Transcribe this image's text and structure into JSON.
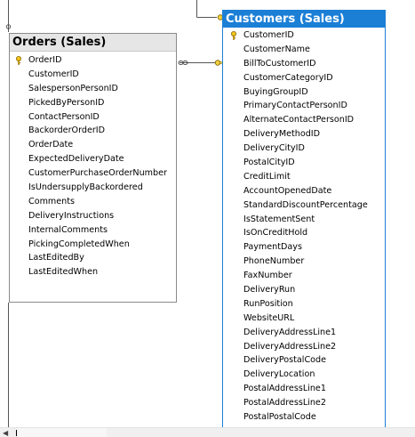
{
  "orders_table": {
    "title": "Orders (Sales)",
    "columns": [
      {
        "name": "OrderID",
        "key": true
      },
      {
        "name": "CustomerID"
      },
      {
        "name": "SalespersonPersonID"
      },
      {
        "name": "PickedByPersonID"
      },
      {
        "name": "ContactPersonID"
      },
      {
        "name": "BackorderOrderID"
      },
      {
        "name": "OrderDate"
      },
      {
        "name": "ExpectedDeliveryDate"
      },
      {
        "name": "CustomerPurchaseOrderNumber"
      },
      {
        "name": "IsUndersupplyBackordered"
      },
      {
        "name": "Comments"
      },
      {
        "name": "DeliveryInstructions"
      },
      {
        "name": "InternalComments"
      },
      {
        "name": "PickingCompletedWhen"
      },
      {
        "name": "LastEditedBy"
      },
      {
        "name": "LastEditedWhen"
      }
    ]
  },
  "customers_table": {
    "title": "Customers (Sales)",
    "selected": true,
    "columns": [
      {
        "name": "CustomerID",
        "key": true
      },
      {
        "name": "CustomerName"
      },
      {
        "name": "BillToCustomerID"
      },
      {
        "name": "CustomerCategoryID"
      },
      {
        "name": "BuyingGroupID"
      },
      {
        "name": "PrimaryContactPersonID"
      },
      {
        "name": "AlternateContactPersonID"
      },
      {
        "name": "DeliveryMethodID"
      },
      {
        "name": "DeliveryCityID"
      },
      {
        "name": "PostalCityID"
      },
      {
        "name": "CreditLimit"
      },
      {
        "name": "AccountOpenedDate"
      },
      {
        "name": "StandardDiscountPercentage"
      },
      {
        "name": "IsStatementSent"
      },
      {
        "name": "IsOnCreditHold"
      },
      {
        "name": "PaymentDays"
      },
      {
        "name": "PhoneNumber"
      },
      {
        "name": "FaxNumber"
      },
      {
        "name": "DeliveryRun"
      },
      {
        "name": "RunPosition"
      },
      {
        "name": "WebsiteURL"
      },
      {
        "name": "DeliveryAddressLine1"
      },
      {
        "name": "DeliveryAddressLine2"
      },
      {
        "name": "DeliveryPostalCode"
      },
      {
        "name": "DeliveryLocation"
      },
      {
        "name": "PostalAddressLine1"
      },
      {
        "name": "PostalAddressLine2"
      },
      {
        "name": "PostalPostalCode"
      }
    ]
  },
  "icons": {
    "primary_key": "key-icon",
    "relationship_many": "infinity-icon",
    "relationship_one": "key-icon"
  },
  "colors": {
    "selected_title_bg": "#1c7fd6",
    "selected_title_text": "#ffffff",
    "title_bg": "#e6e6e6",
    "key_gold": "#d4a017"
  }
}
